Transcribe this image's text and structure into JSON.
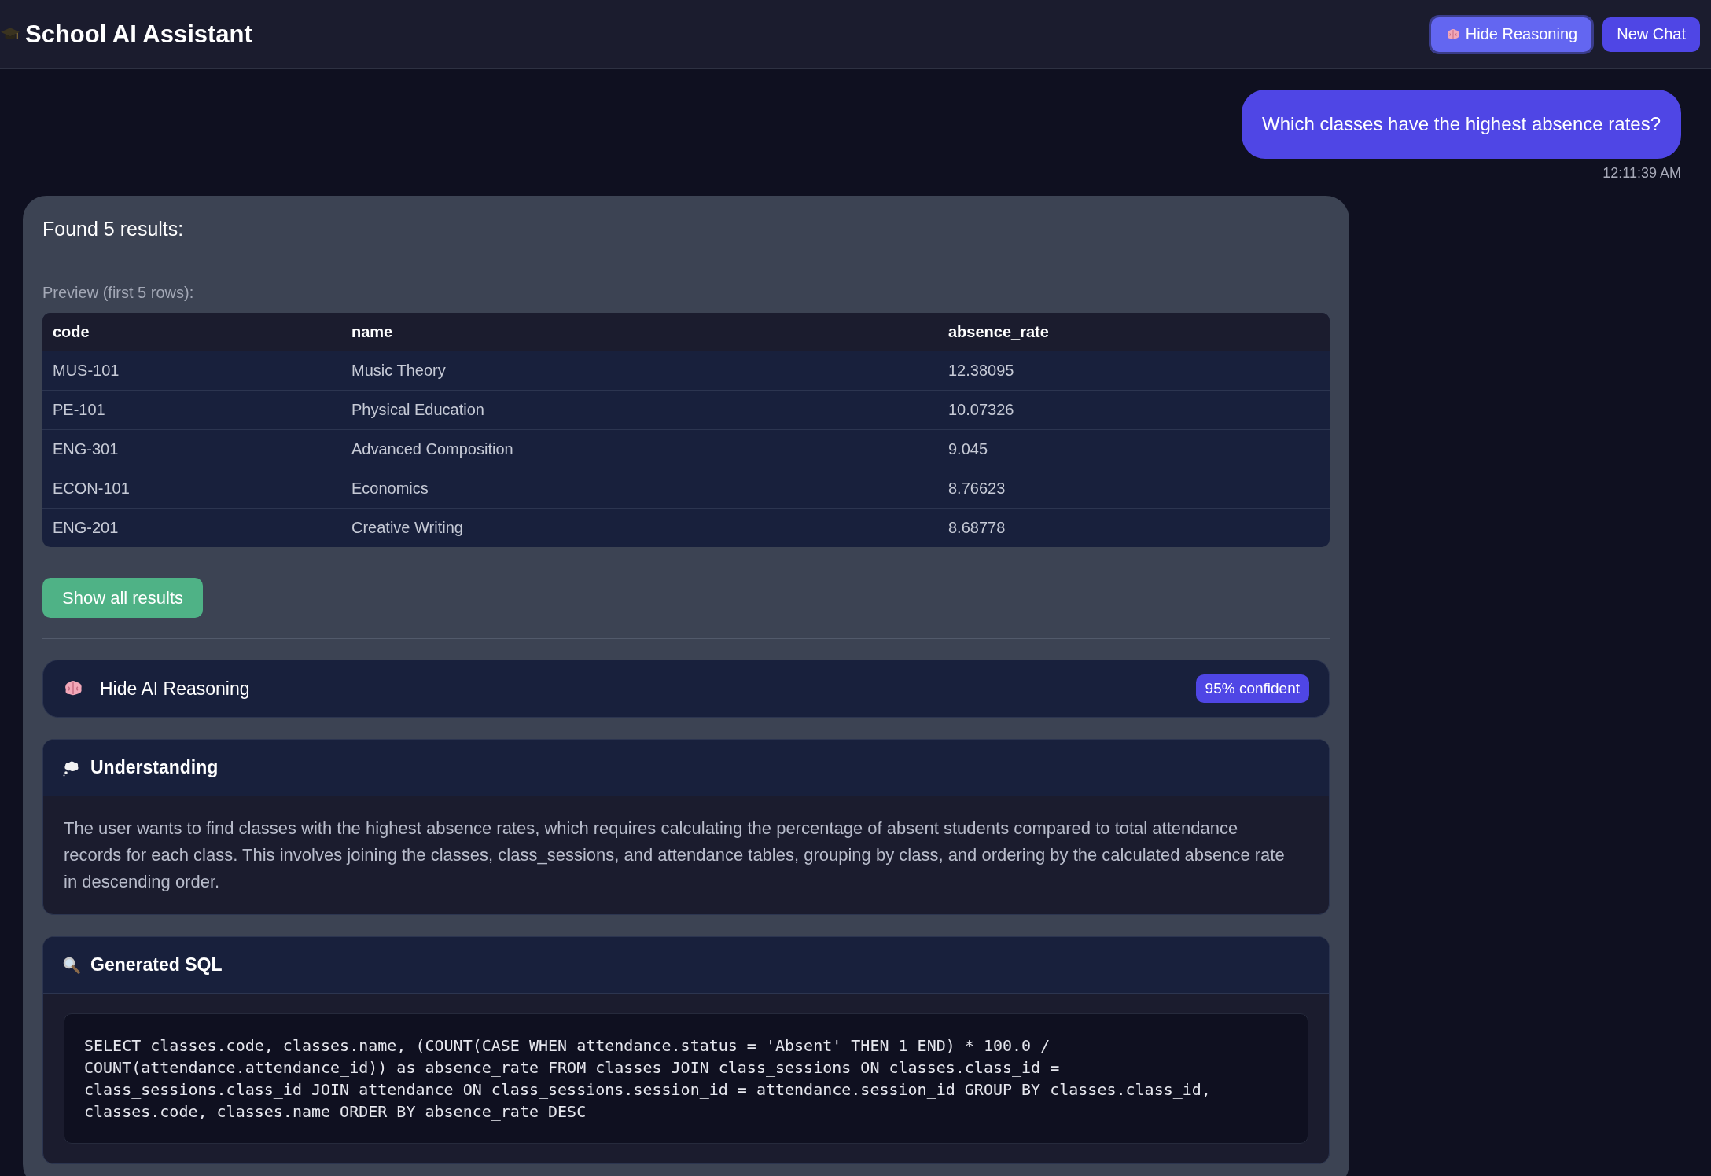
{
  "header": {
    "title": "School AI Assistant",
    "buttons": [
      {
        "label": "Hide Reasoning",
        "kind": "toggle",
        "selected": true
      },
      {
        "label": "New Chat",
        "kind": "plain",
        "selected": false
      }
    ]
  },
  "user_message": {
    "text": "Which classes have the highest absence rates?",
    "time": "12:11:39 AM"
  },
  "result": {
    "summary": "Found 5 results:",
    "preview_label": "Preview (first 5 rows):",
    "table": {
      "columns": [
        "code",
        "name",
        "absence_rate"
      ],
      "rows": [
        [
          "MUS-101",
          "Music Theory",
          "12.38095"
        ],
        [
          "PE-101",
          "Physical Education",
          "10.07326"
        ],
        [
          "ENG-301",
          "Advanced Composition",
          "9.045"
        ],
        [
          "ECON-101",
          "Economics",
          "8.76623"
        ],
        [
          "ENG-201",
          "Creative Writing",
          "8.68778"
        ]
      ]
    },
    "show_all_button": "Show all results",
    "reasoning": {
      "toggle_label": "Hide AI Reasoning",
      "expanded": true,
      "confidence": "95% confident",
      "sections": [
        {
          "kind": "text",
          "title": "Understanding",
          "body": "The user wants to find classes with the highest absence rates, which requires calculating the percentage of absent students compared to total attendance records for each class. This involves joining the classes, class_sessions, and attendance tables, grouping by class, and ordering by the calculated absence rate in descending order."
        },
        {
          "kind": "code",
          "title": "Generated SQL",
          "lines": [
            "SELECT classes.code, classes.name, (COUNT(CASE WHEN attendance.status = 'Absent' THEN 1 END) * 100.0 /",
            "COUNT(attendance.attendance_id)) as absence_rate FROM classes JOIN class_sessions ON classes.class_id =",
            "class_sessions.class_id JOIN attendance ON class_sessions.session_id = attendance.session_id GROUP BY classes.class_id,",
            "classes.code, classes.name ORDER BY absence_rate DESC"
          ]
        }
      ]
    }
  }
}
